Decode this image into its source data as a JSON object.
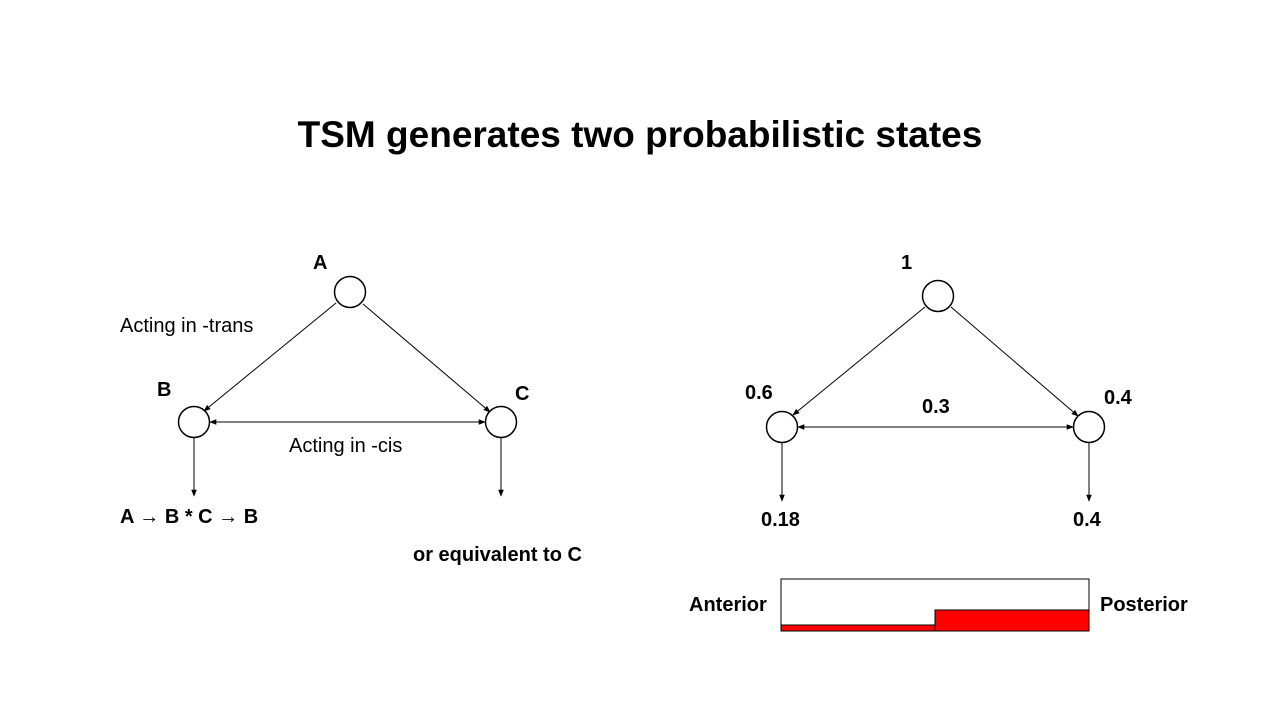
{
  "title": "TSM generates two probabilistic states",
  "left_diagram": {
    "nodes": {
      "a": "A",
      "b": "B",
      "c": "C"
    },
    "labels": {
      "trans": "Acting in -trans",
      "cis": "Acting in -cis",
      "formula": "A → B * C → B",
      "equivalent": "or equivalent to C"
    }
  },
  "right_diagram": {
    "nodes": {
      "top": "1",
      "left": "0.6",
      "right": "0.4"
    },
    "edge_label": "0.3",
    "outputs": {
      "left": "0.18",
      "right": "0.4"
    }
  },
  "gradient_bar": {
    "left_label": "Anterior",
    "right_label": "Posterior",
    "fill_color": "#ff0000",
    "levels": [
      0.3,
      1.0
    ]
  }
}
